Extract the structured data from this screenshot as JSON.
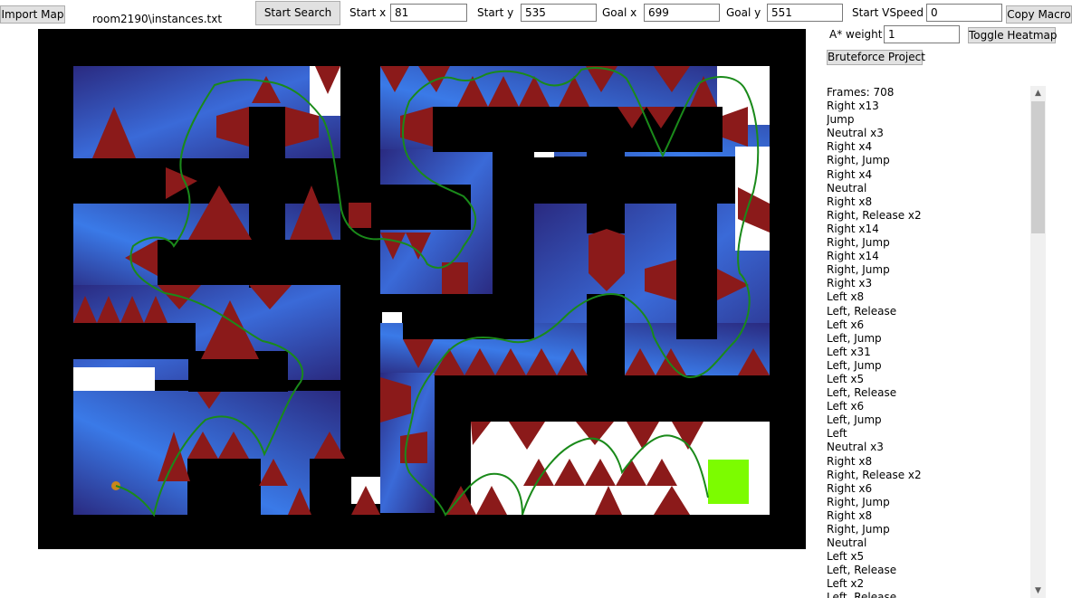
{
  "toolbar": {
    "import_label": "Import Map",
    "map_file": "room2190\\instances.txt",
    "start_search_label": "Start Search",
    "start_x_label": "Start x",
    "start_x_value": "81",
    "start_y_label": "Start y",
    "start_y_value": "535",
    "goal_x_label": "Goal x",
    "goal_x_value": "699",
    "goal_y_label": "Goal y",
    "goal_y_value": "551",
    "start_vspeed_label": "Start VSpeed",
    "start_vspeed_value": "0",
    "copy_macro_label": "Copy Macro",
    "astar_weight_label": "A* weight",
    "astar_weight_value": "1",
    "toggle_heatmap_label": "Toggle Heatmap",
    "bruteforce_label": "Bruteforce Project"
  },
  "macro": {
    "lines": [
      "Frames: 708",
      "Right x13",
      "Jump",
      "Neutral x3",
      "Right x4",
      "Right, Jump",
      "Right x4",
      "Neutral",
      "Right x8",
      "Right, Release x2",
      "Right x14",
      "Right, Jump",
      "Right x14",
      "Right, Jump",
      "Right x3",
      "Left x8",
      "Left, Release",
      "Left x6",
      "Left, Jump",
      "Left x31",
      "Left, Jump",
      "Left x5",
      "Left, Release",
      "Left x6",
      "Left, Jump",
      "Left",
      "Neutral x3",
      "Right x8",
      "Right, Release x2",
      "Right x6",
      "Right, Jump",
      "Right x8",
      "Right, Jump",
      "Neutral",
      "Left x5",
      "Left, Release",
      "Left x2",
      "Left, Release"
    ]
  },
  "colors": {
    "wall": "#000000",
    "spike": "#8b1a1a",
    "heat_dark": "#2a2a80",
    "heat_bright": "#3a7ae8",
    "path": "#1a8a1a",
    "goal": "#7cfc00",
    "start": "#c8861a"
  },
  "icons": {
    "scroll_up": "chevron-up-icon",
    "scroll_down": "chevron-down-icon"
  }
}
